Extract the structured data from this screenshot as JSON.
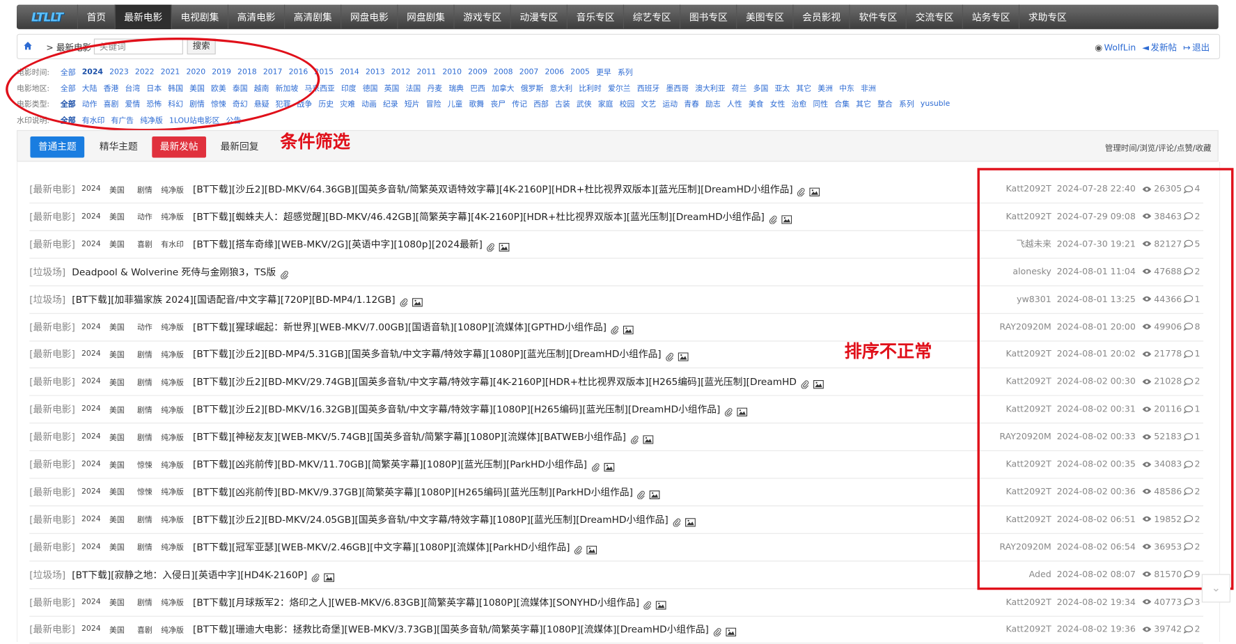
{
  "logo": "LTLLT",
  "nav": [
    "首页",
    "最新电影",
    "电视剧集",
    "高清电影",
    "高清剧集",
    "网盘电影",
    "网盘剧集",
    "游戏专区",
    "动漫专区",
    "音乐专区",
    "综艺专区",
    "图书专区",
    "美图专区",
    "会员影视",
    "软件专区",
    "交流专区",
    "站务专区",
    "求助专区"
  ],
  "nav_active": "最新电影",
  "crumb": "> 最新电影",
  "search": {
    "placeholder": "关键词",
    "button": "搜索"
  },
  "user": {
    "name": "WolfLin",
    "post": "发新帖",
    "logout": "退出"
  },
  "filters": {
    "year": {
      "label": "电影时间:",
      "options": [
        "全部",
        "2024",
        "2023",
        "2022",
        "2021",
        "2020",
        "2019",
        "2018",
        "2017",
        "2016",
        "2015",
        "2014",
        "2013",
        "2012",
        "2011",
        "2010",
        "2009",
        "2008",
        "2007",
        "2006",
        "2005",
        "更早",
        "系列"
      ],
      "selected": "2024"
    },
    "region": {
      "label": "电影地区:",
      "options": [
        "全部",
        "大陆",
        "香港",
        "台湾",
        "日本",
        "韩国",
        "美国",
        "欧美",
        "泰国",
        "越南",
        "新加坡",
        "马来西亚",
        "印度",
        "德国",
        "英国",
        "法国",
        "丹麦",
        "瑞典",
        "巴西",
        "加拿大",
        "俄罗斯",
        "意大利",
        "比利时",
        "爱尔兰",
        "西班牙",
        "墨西哥",
        "澳大利亚",
        "荷兰",
        "多国",
        "亚太",
        "其它",
        "美洲",
        "中东",
        "非洲"
      ],
      "selected": ""
    },
    "genre": {
      "label": "电影类型:",
      "options": [
        "全部",
        "动作",
        "喜剧",
        "爱情",
        "恐怖",
        "科幻",
        "剧情",
        "惊悚",
        "奇幻",
        "悬疑",
        "犯罪",
        "战争",
        "历史",
        "灾难",
        "动画",
        "纪录",
        "短片",
        "冒险",
        "儿童",
        "歌舞",
        "丧尸",
        "传记",
        "西部",
        "古装",
        "武侠",
        "家庭",
        "校园",
        "文艺",
        "运动",
        "青春",
        "励志",
        "人性",
        "美食",
        "女性",
        "治愈",
        "同性",
        "合集",
        "其它",
        "整合",
        "系列",
        "yusuble"
      ],
      "selected": "全部"
    },
    "watermark": {
      "label": "水印说明:",
      "options": [
        "全部",
        "有水印",
        "有广告",
        "纯净版",
        "1LOU站电影区",
        "公告"
      ],
      "selected": "全部"
    }
  },
  "annotations": {
    "filter_note": "条件筛选",
    "sort_note": "排序不正常"
  },
  "tabs": {
    "normal": "普通主题",
    "digest": "精华主题",
    "latest_post": "最新发帖",
    "latest_reply": "最新回复"
  },
  "sort_options": "管理时间/浏览/评论/点赞/收藏",
  "threads": [
    {
      "cat": "[最新电影]",
      "tags": [
        "2024",
        "美国",
        "剧情",
        "纯净版"
      ],
      "title": "[BT下载][沙丘2][BD-MKV/64.36GB][国英多音轨/简繁英双语特效字幕][4K-2160P][HDR+杜比视界双版本][蓝光压制][DreamHD小组作品]",
      "author": "Katt2092T",
      "date": "2024-07-28 22:40",
      "views": "26305",
      "replies": "4"
    },
    {
      "cat": "[最新电影]",
      "tags": [
        "2024",
        "美国",
        "动作",
        "纯净版"
      ],
      "title": "[BT下载][蜘蛛夫人：超感觉醒][BD-MKV/46.42GB][简繁英字幕][4K-2160P][HDR+杜比视界双版本][蓝光压制][DreamHD小组作品]",
      "author": "Katt2092T",
      "date": "2024-07-29 09:08",
      "views": "38463",
      "replies": "2"
    },
    {
      "cat": "[最新电影]",
      "tags": [
        "2024",
        "美国",
        "喜剧",
        "有水印"
      ],
      "title": "[BT下载][搭车奇缘][WEB-MKV/2G][英语中字][1080p][2024最新]",
      "author": "飞越未来",
      "date": "2024-07-30 19:21",
      "views": "82127",
      "replies": "5"
    },
    {
      "cat": "[垃圾场]",
      "tags": [],
      "title": "Deadpool & Wolverine 死侍与金刚狼3，TS版",
      "author": "alonesky",
      "date": "2024-08-01 11:04",
      "views": "47688",
      "replies": "2",
      "noimg": true
    },
    {
      "cat": "[垃圾场]",
      "tags": [],
      "title": "[BT下载][加菲猫家族 2024][国语配音/中文字幕][720P][BD-MP4/1.12GB]",
      "author": "yw8301",
      "date": "2024-08-01 13:25",
      "views": "44366",
      "replies": "1"
    },
    {
      "cat": "[最新电影]",
      "tags": [
        "2024",
        "美国",
        "动作",
        "纯净版"
      ],
      "title": "[BT下载][猩球崛起：新世界][WEB-MKV/7.00GB][国语音轨][1080P][流媒体][GPTHD小组作品]",
      "author": "RAY20920M",
      "date": "2024-08-01 20:00",
      "views": "49906",
      "replies": "8"
    },
    {
      "cat": "[最新电影]",
      "tags": [
        "2024",
        "美国",
        "剧情",
        "纯净版"
      ],
      "title": "[BT下载][沙丘2][BD-MP4/5.31GB][国英多音轨/中文字幕/特效字幕][1080P][蓝光压制][DreamHD小组作品]",
      "author": "Katt2092T",
      "date": "2024-08-01 20:02",
      "views": "21778",
      "replies": "1"
    },
    {
      "cat": "[最新电影]",
      "tags": [
        "2024",
        "美国",
        "剧情",
        "纯净版"
      ],
      "title": "[BT下载][沙丘2][BD-MKV/29.74GB][国英多音轨/中文字幕/特效字幕][4K-2160P][HDR+杜比视界双版本][H265编码][蓝光压制][DreamHD",
      "author": "Katt2092T",
      "date": "2024-08-02 00:30",
      "views": "21028",
      "replies": "2"
    },
    {
      "cat": "[最新电影]",
      "tags": [
        "2024",
        "美国",
        "剧情",
        "纯净版"
      ],
      "title": "[BT下载][沙丘2][BD-MKV/16.32GB][国英多音轨/中文字幕/特效字幕][1080P][H265编码][蓝光压制][DreamHD小组作品]",
      "author": "Katt2092T",
      "date": "2024-08-02 00:31",
      "views": "20116",
      "replies": "1"
    },
    {
      "cat": "[最新电影]",
      "tags": [
        "2024",
        "美国",
        "剧情",
        "纯净版"
      ],
      "title": "[BT下载][神秘友友][WEB-MKV/5.74GB][国英多音轨/简繁字幕][1080P][流媒体][BATWEB小组作品]",
      "author": "RAY20920M",
      "date": "2024-08-02 00:33",
      "views": "52183",
      "replies": "1"
    },
    {
      "cat": "[最新电影]",
      "tags": [
        "2024",
        "美国",
        "惊悚",
        "纯净版"
      ],
      "title": "[BT下载][凶兆前传][BD-MKV/11.70GB][简繁英字幕][1080P][蓝光压制][ParkHD小组作品]",
      "author": "Katt2092T",
      "date": "2024-08-02 00:35",
      "views": "34083",
      "replies": "2"
    },
    {
      "cat": "[最新电影]",
      "tags": [
        "2024",
        "美国",
        "惊悚",
        "纯净版"
      ],
      "title": "[BT下载][凶兆前传][BD-MKV/9.37GB][简繁英字幕][1080P][H265编码][蓝光压制][ParkHD小组作品]",
      "author": "Katt2092T",
      "date": "2024-08-02 00:36",
      "views": "48586",
      "replies": "2"
    },
    {
      "cat": "[最新电影]",
      "tags": [
        "2024",
        "美国",
        "剧情",
        "纯净版"
      ],
      "title": "[BT下载][沙丘2][BD-MKV/24.05GB][国英多音轨/中文字幕/特效字幕][1080P][蓝光压制][DreamHD小组作品]",
      "author": "Katt2092T",
      "date": "2024-08-02 06:51",
      "views": "19852",
      "replies": "2"
    },
    {
      "cat": "[最新电影]",
      "tags": [
        "2024",
        "美国",
        "剧情",
        "纯净版"
      ],
      "title": "[BT下载][冠军亚瑟][WEB-MKV/2.46GB][中文字幕][1080P][流媒体][ParkHD小组作品]",
      "author": "RAY20920M",
      "date": "2024-08-02 06:54",
      "views": "36953",
      "replies": "2"
    },
    {
      "cat": "[垃圾场]",
      "tags": [],
      "title": "[BT下载][寂静之地：入侵日][英语中字][HD4K-2160P]",
      "author": "Aded",
      "date": "2024-08-02 08:07",
      "views": "81570",
      "replies": "9"
    },
    {
      "cat": "[最新电影]",
      "tags": [
        "2024",
        "美国",
        "剧情",
        "纯净版"
      ],
      "title": "[BT下载][月球叛军2：烙印之人][WEB-MKV/6.83GB][简繁英字幕][1080P][流媒体][SONYHD小组作品]",
      "author": "Katt2092T",
      "date": "2024-08-02 19:34",
      "views": "40773",
      "replies": "3"
    },
    {
      "cat": "[最新电影]",
      "tags": [
        "2024",
        "美国",
        "喜剧",
        "纯净版"
      ],
      "title": "[BT下载][珊迪大电影：拯救比奇堡][WEB-MKV/3.73GB][国英多音轨/简繁英字幕][1080P][流媒体][DreamHD小组作品]",
      "author": "Katt2092T",
      "date": "2024-08-02 19:36",
      "views": "39742",
      "replies": "2"
    }
  ]
}
